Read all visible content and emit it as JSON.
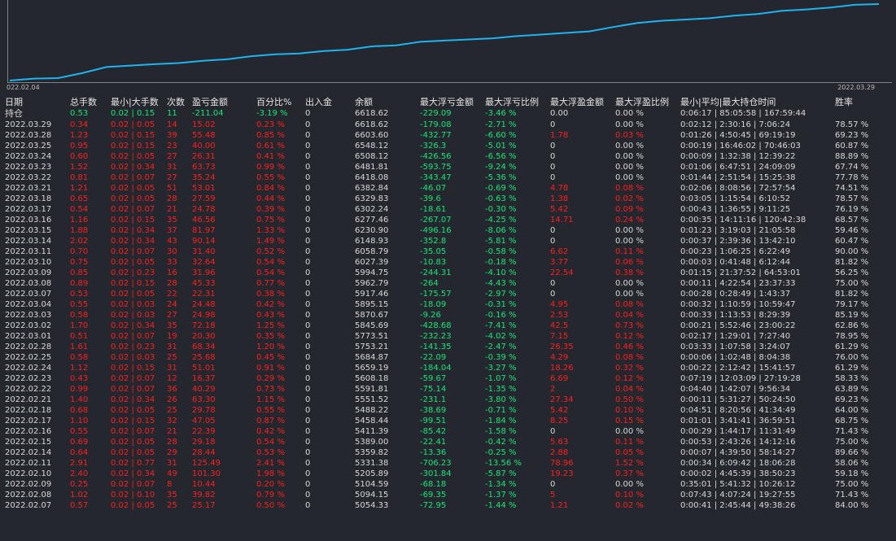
{
  "chart": {
    "start_date": "022.02.04",
    "end_date": "2022.03.29",
    "line_color": "#1eb4f0",
    "curve": [
      5054.33,
      5094.15,
      5104.59,
      5205.89,
      5331.38,
      5359.82,
      5389.0,
      5411.39,
      5458.44,
      5488.22,
      5551.52,
      5591.81,
      5608.18,
      5659.19,
      5684.87,
      5753.21,
      5773.51,
      5845.69,
      5870.67,
      5895.15,
      5917.46,
      5962.79,
      5994.75,
      6027.39,
      6058.79,
      6148.93,
      6230.9,
      6277.46,
      6302.24,
      6329.83,
      6382.84,
      6418.08,
      6481.81,
      6508.12,
      6548.12,
      6603.6,
      6618.62
    ]
  },
  "headers": {
    "date": "日期",
    "lots": "总手数",
    "minmax_lots": "最小|大手数",
    "count": "次数",
    "profit": "盈亏金额",
    "percent": "百分比%",
    "inout": "出入金",
    "balance": "余额",
    "max_float_loss": "最大浮亏金额",
    "max_float_loss_ratio": "最大浮亏比例",
    "max_float_profit": "最大浮盈金额",
    "max_float_profit_ratio": "最大浮盈比例",
    "hold_time": "最小|平均|最大持仓时间",
    "winrate": "胜率"
  },
  "position_row": {
    "label": "持仓",
    "lots": "0.53",
    "minmax": "0.02 | 0.15",
    "count": "11",
    "profit": "-211.04",
    "percent": "-3.19 %",
    "inout": "0",
    "balance": "6618.62",
    "mfl": "-229.09",
    "mflr": "-3.46 %",
    "mfp": "0.00",
    "mfpr": "0.00 %",
    "hold": "0:06:17 | 85:05:58 | 167:59:44",
    "win": ""
  },
  "rows": [
    {
      "date": "2022.03.29",
      "lots": "0.34",
      "minmax": "0.02 | 0.05",
      "count": "14",
      "profit": "15.02",
      "percent": "0.23 %",
      "inout": "0",
      "balance": "6618.62",
      "mfl": "-179.08",
      "mflr": "-2.71 %",
      "mfp": "0",
      "mfpr": "0.00 %",
      "hold": "0:02:12 | 2:30:16 | 7:06:24",
      "win": "78.57 %"
    },
    {
      "date": "2022.03.28",
      "lots": "1.23",
      "minmax": "0.02 | 0.15",
      "count": "39",
      "profit": "55.48",
      "percent": "0.85 %",
      "inout": "0",
      "balance": "6603.60",
      "mfl": "-432.77",
      "mflr": "-6.60 %",
      "mfp": "1.78",
      "mfpr": "0.03 %",
      "hold": "0:01:26 | 4:50:45 | 69:19:19",
      "win": "69.23 %"
    },
    {
      "date": "2022.03.25",
      "lots": "0.95",
      "minmax": "0.02 | 0.15",
      "count": "23",
      "profit": "40.00",
      "percent": "0.61 %",
      "inout": "0",
      "balance": "6548.12",
      "mfl": "-326.3",
      "mflr": "-5.01 %",
      "mfp": "0",
      "mfpr": "0.00 %",
      "hold": "0:00:19 | 16:46:02 | 70:46:03",
      "win": "60.87 %"
    },
    {
      "date": "2022.03.24",
      "lots": "0.60",
      "minmax": "0.02 | 0.05",
      "count": "27",
      "profit": "26.31",
      "percent": "0.41 %",
      "inout": "0",
      "balance": "6508.12",
      "mfl": "-426.56",
      "mflr": "-6.56 %",
      "mfp": "0",
      "mfpr": "0.00 %",
      "hold": "0:00:09 | 1:32:38 | 12:39:22",
      "win": "88.89 %"
    },
    {
      "date": "2022.03.23",
      "lots": "1.52",
      "minmax": "0.02 | 0.34",
      "count": "31",
      "profit": "63.73",
      "percent": "0.99 %",
      "inout": "0",
      "balance": "6481.81",
      "mfl": "-593.75",
      "mflr": "-9.24 %",
      "mfp": "0",
      "mfpr": "0.00 %",
      "hold": "0:01:06 | 6:47:51 | 24:09:09",
      "win": "67.74 %"
    },
    {
      "date": "2022.03.22",
      "lots": "0.81",
      "minmax": "0.02 | 0.07",
      "count": "27",
      "profit": "35.24",
      "percent": "0.55 %",
      "inout": "0",
      "balance": "6418.08",
      "mfl": "-343.47",
      "mflr": "-5.36 %",
      "mfp": "0",
      "mfpr": "0.00 %",
      "hold": "0:01:44 | 2:51:54 | 15:25:38",
      "win": "77.78 %"
    },
    {
      "date": "2022.03.21",
      "lots": "1.21",
      "minmax": "0.02 | 0.05",
      "count": "51",
      "profit": "53.01",
      "percent": "0.84 %",
      "inout": "0",
      "balance": "6382.84",
      "mfl": "-46.07",
      "mflr": "-0.69 %",
      "mfp": "4.78",
      "mfpr": "0.08 %",
      "hold": "0:02:06 | 8:08:56 | 72:57:54",
      "win": "74.51 %"
    },
    {
      "date": "2022.03.18",
      "lots": "0.65",
      "minmax": "0.02 | 0.05",
      "count": "28",
      "profit": "27.59",
      "percent": "0.44 %",
      "inout": "0",
      "balance": "6329.83",
      "mfl": "-39.6",
      "mflr": "-0.63 %",
      "mfp": "1.38",
      "mfpr": "0.02 %",
      "hold": "0:03:05 | 1:15:54 | 6:10:52",
      "win": "78.57 %"
    },
    {
      "date": "2022.03.17",
      "lots": "0.54",
      "minmax": "0.02 | 0.07",
      "count": "21",
      "profit": "24.78",
      "percent": "0.39 %",
      "inout": "0",
      "balance": "6302.24",
      "mfl": "-18.61",
      "mflr": "-0.30 %",
      "mfp": "5.42",
      "mfpr": "0.09 %",
      "hold": "0:00:43 | 1:36:55 | 9:11:25",
      "win": "76.19 %"
    },
    {
      "date": "2022.03.16",
      "lots": "1.16",
      "minmax": "0.02 | 0.15",
      "count": "35",
      "profit": "46.56",
      "percent": "0.75 %",
      "inout": "0",
      "balance": "6277.46",
      "mfl": "-267.07",
      "mflr": "-4.25 %",
      "mfp": "14.71",
      "mfpr": "0.24 %",
      "hold": "0:00:35 | 14:11:16 | 120:42:38",
      "win": "68.57 %"
    },
    {
      "date": "2022.03.15",
      "lots": "1.88",
      "minmax": "0.02 | 0.34",
      "count": "37",
      "profit": "81.97",
      "percent": "1.33 %",
      "inout": "0",
      "balance": "6230.90",
      "mfl": "-496.16",
      "mflr": "-8.06 %",
      "mfp": "0",
      "mfpr": "0.00 %",
      "hold": "0:01:23 | 3:19:03 | 21:05:58",
      "win": "59.46 %"
    },
    {
      "date": "2022.03.14",
      "lots": "2.02",
      "minmax": "0.02 | 0.34",
      "count": "43",
      "profit": "90.14",
      "percent": "1.49 %",
      "inout": "0",
      "balance": "6148.93",
      "mfl": "-352.8",
      "mflr": "-5.81 %",
      "mfp": "0",
      "mfpr": "0.00 %",
      "hold": "0:00:37 | 2:39:36 | 13:42:10",
      "win": "60.47 %"
    },
    {
      "date": "2022.03.11",
      "lots": "0.70",
      "minmax": "0.02 | 0.07",
      "count": "30",
      "profit": "31.40",
      "percent": "0.52 %",
      "inout": "0",
      "balance": "6058.79",
      "mfl": "-35.05",
      "mflr": "-0.58 %",
      "mfp": "6.62",
      "mfpr": "0.11 %",
      "hold": "0:00:23 | 1:06:25 | 6:22:49",
      "win": "90.00 %"
    },
    {
      "date": "2022.03.10",
      "lots": "0.75",
      "minmax": "0.02 | 0.05",
      "count": "33",
      "profit": "32.64",
      "percent": "0.54 %",
      "inout": "0",
      "balance": "6027.39",
      "mfl": "-10.83",
      "mflr": "-0.18 %",
      "mfp": "3.77",
      "mfpr": "0.06 %",
      "hold": "0:00:03 | 0:41:48 | 6:12:44",
      "win": "81.82 %"
    },
    {
      "date": "2022.03.09",
      "lots": "0.85",
      "minmax": "0.02 | 0.23",
      "count": "16",
      "profit": "31.96",
      "percent": "0.54 %",
      "inout": "0",
      "balance": "5994.75",
      "mfl": "-244.31",
      "mflr": "-4.10 %",
      "mfp": "22.54",
      "mfpr": "0.38 %",
      "hold": "0:01:15 | 21:37:52 | 64:53:01",
      "win": "56.25 %"
    },
    {
      "date": "2022.03.08",
      "lots": "0.89",
      "minmax": "0.02 | 0.15",
      "count": "28",
      "profit": "45.33",
      "percent": "0.77 %",
      "inout": "0",
      "balance": "5962.79",
      "mfl": "-264",
      "mflr": "-4.43 %",
      "mfp": "0",
      "mfpr": "0.00 %",
      "hold": "0:00:11 | 4:22:54 | 23:37:33",
      "win": "75.00 %"
    },
    {
      "date": "2022.03.07",
      "lots": "0.53",
      "minmax": "0.02 | 0.05",
      "count": "22",
      "profit": "22.31",
      "percent": "0.38 %",
      "inout": "0",
      "balance": "5917.46",
      "mfl": "-175.57",
      "mflr": "-2.97 %",
      "mfp": "0",
      "mfpr": "0.00 %",
      "hold": "0:00:28 | 0:28:49 | 1:43:37",
      "win": "81.82 %"
    },
    {
      "date": "2022.03.04",
      "lots": "0.55",
      "minmax": "0.02 | 0.03",
      "count": "24",
      "profit": "24.48",
      "percent": "0.42 %",
      "inout": "0",
      "balance": "5895.15",
      "mfl": "-18.09",
      "mflr": "-0.31 %",
      "mfp": "4.95",
      "mfpr": "0.08 %",
      "hold": "0:00:32 | 1:10:59 | 10:59:47",
      "win": "79.17 %"
    },
    {
      "date": "2022.03.03",
      "lots": "0.58",
      "minmax": "0.02 | 0.03",
      "count": "27",
      "profit": "24.98",
      "percent": "0.43 %",
      "inout": "0",
      "balance": "5870.67",
      "mfl": "-9.26",
      "mflr": "-0.16 %",
      "mfp": "2.53",
      "mfpr": "0.04 %",
      "hold": "0:00:33 | 1:13:53 | 8:29:39",
      "win": "85.19 %"
    },
    {
      "date": "2022.03.02",
      "lots": "1.70",
      "minmax": "0.02 | 0.34",
      "count": "35",
      "profit": "72.18",
      "percent": "1.25 %",
      "inout": "0",
      "balance": "5845.69",
      "mfl": "-428.68",
      "mflr": "-7.41 %",
      "mfp": "42.5",
      "mfpr": "0.73 %",
      "hold": "0:00:21 | 5:52:46 | 23:00:22",
      "win": "62.86 %"
    },
    {
      "date": "2022.03.01",
      "lots": "0.51",
      "minmax": "0.02 | 0.07",
      "count": "19",
      "profit": "20.30",
      "percent": "0.35 %",
      "inout": "0",
      "balance": "5773.51",
      "mfl": "-232.23",
      "mflr": "-4.02 %",
      "mfp": "7.15",
      "mfpr": "0.12 %",
      "hold": "0:02:17 | 1:29:01 | 7:27:40",
      "win": "78.95 %"
    },
    {
      "date": "2022.02.28",
      "lots": "1.61",
      "minmax": "0.02 | 0.23",
      "count": "31",
      "profit": "68.34",
      "percent": "1.20 %",
      "inout": "0",
      "balance": "5753.21",
      "mfl": "-141.35",
      "mflr": "-2.47 %",
      "mfp": "26.35",
      "mfpr": "0.46 %",
      "hold": "0:03:33 | 1:07:58 | 3:24:07",
      "win": "61.29 %"
    },
    {
      "date": "2022.02.25",
      "lots": "0.58",
      "minmax": "0.02 | 0.03",
      "count": "25",
      "profit": "25.68",
      "percent": "0.45 %",
      "inout": "0",
      "balance": "5684.87",
      "mfl": "-22.09",
      "mflr": "-0.39 %",
      "mfp": "4.29",
      "mfpr": "0.08 %",
      "hold": "0:00:06 | 1:02:48 | 8:04:38",
      "win": "76.00 %"
    },
    {
      "date": "2022.02.24",
      "lots": "1.12",
      "minmax": "0.02 | 0.15",
      "count": "31",
      "profit": "51.01",
      "percent": "0.91 %",
      "inout": "0",
      "balance": "5659.19",
      "mfl": "-184.04",
      "mflr": "-3.27 %",
      "mfp": "18.26",
      "mfpr": "0.32 %",
      "hold": "0:00:22 | 2:12:42 | 15:41:57",
      "win": "61.29 %"
    },
    {
      "date": "2022.02.23",
      "lots": "0.43",
      "minmax": "0.02 | 0.07",
      "count": "12",
      "profit": "16.37",
      "percent": "0.29 %",
      "inout": "0",
      "balance": "5608.18",
      "mfl": "-59.67",
      "mflr": "-1.07 %",
      "mfp": "6.69",
      "mfpr": "0.12 %",
      "hold": "0:07:19 | 12:03:09 | 27:19:28",
      "win": "58.33 %"
    },
    {
      "date": "2022.02.22",
      "lots": "0.99",
      "minmax": "0.02 | 0.07",
      "count": "36",
      "profit": "40.29",
      "percent": "0.73 %",
      "inout": "0",
      "balance": "5591.81",
      "mfl": "-75.14",
      "mflr": "-1.35 %",
      "mfp": "2",
      "mfpr": "0.04 %",
      "hold": "0:04:40 | 1:42:07 | 9:56:34",
      "win": "63.89 %"
    },
    {
      "date": "2022.02.21",
      "lots": "1.40",
      "minmax": "0.02 | 0.34",
      "count": "26",
      "profit": "63.30",
      "percent": "1.15 %",
      "inout": "0",
      "balance": "5551.52",
      "mfl": "-231.1",
      "mflr": "-3.80 %",
      "mfp": "27.34",
      "mfpr": "0.50 %",
      "hold": "0:00:11 | 5:31:27 | 50:24:50",
      "win": "69.23 %"
    },
    {
      "date": "2022.02.18",
      "lots": "0.68",
      "minmax": "0.02 | 0.05",
      "count": "25",
      "profit": "29.78",
      "percent": "0.55 %",
      "inout": "0",
      "balance": "5488.22",
      "mfl": "-38.69",
      "mflr": "-0.71 %",
      "mfp": "5.42",
      "mfpr": "0.10 %",
      "hold": "0:04:51 | 8:20:56 | 41:34:49",
      "win": "64.00 %"
    },
    {
      "date": "2022.02.17",
      "lots": "1.10",
      "minmax": "0.02 | 0.15",
      "count": "32",
      "profit": "47.05",
      "percent": "0.87 %",
      "inout": "0",
      "balance": "5458.44",
      "mfl": "-99.51",
      "mflr": "-1.84 %",
      "mfp": "8.25",
      "mfpr": "0.15 %",
      "hold": "0:01:01 | 3:41:41 | 36:59:51",
      "win": "68.75 %"
    },
    {
      "date": "2022.02.16",
      "lots": "0.55",
      "minmax": "0.02 | 0.07",
      "count": "21",
      "profit": "22.39",
      "percent": "0.42 %",
      "inout": "0",
      "balance": "5411.39",
      "mfl": "-85.42",
      "mflr": "-1.58 %",
      "mfp": "0",
      "mfpr": "0.00 %",
      "hold": "0:00:29 | 1:44:17 | 11:31:49",
      "win": "71.43 %"
    },
    {
      "date": "2022.02.15",
      "lots": "0.69",
      "minmax": "0.02 | 0.05",
      "count": "28",
      "profit": "29.18",
      "percent": "0.54 %",
      "inout": "0",
      "balance": "5389.00",
      "mfl": "-22.41",
      "mflr": "-0.42 %",
      "mfp": "5.63",
      "mfpr": "0.11 %",
      "hold": "0:00:53 | 2:43:26 | 14:12:16",
      "win": "75.00 %"
    },
    {
      "date": "2022.02.14",
      "lots": "0.64",
      "minmax": "0.02 | 0.05",
      "count": "29",
      "profit": "28.44",
      "percent": "0.53 %",
      "inout": "0",
      "balance": "5359.82",
      "mfl": "-13.36",
      "mflr": "-0.25 %",
      "mfp": "2.88",
      "mfpr": "0.05 %",
      "hold": "0:00:07 | 4:39:50 | 58:14:27",
      "win": "89.66 %"
    },
    {
      "date": "2022.02.11",
      "lots": "2.91",
      "minmax": "0.02 | 0.77",
      "count": "31",
      "profit": "125.49",
      "percent": "2.41 %",
      "inout": "0",
      "balance": "5331.38",
      "mfl": "-706.23",
      "mflr": "-13.56 %",
      "mfp": "78.96",
      "mfpr": "1.52 %",
      "hold": "0:00:34 | 6:09:42 | 18:06:28",
      "win": "58.06 %"
    },
    {
      "date": "2022.02.10",
      "lots": "2.40",
      "minmax": "0.02 | 0.34",
      "count": "49",
      "profit": "101.30",
      "percent": "1.98 %",
      "inout": "0",
      "balance": "5205.89",
      "mfl": "-301.84",
      "mflr": "-5.87 %",
      "mfp": "19.23",
      "mfpr": "0.37 %",
      "hold": "0:00:02 | 4:45:39 | 38:50:23",
      "win": "59.18 %"
    },
    {
      "date": "2022.02.09",
      "lots": "0.25",
      "minmax": "0.02 | 0.07",
      "count": "8",
      "profit": "10.44",
      "percent": "0.20 %",
      "inout": "0",
      "balance": "5104.59",
      "mfl": "-68.18",
      "mflr": "-1.34 %",
      "mfp": "0",
      "mfpr": "0.00 %",
      "hold": "0:35:01 | 5:41:32 | 10:26:12",
      "win": "75.00 %"
    },
    {
      "date": "2022.02.08",
      "lots": "1.02",
      "minmax": "0.02 | 0.10",
      "count": "35",
      "profit": "39.82",
      "percent": "0.79 %",
      "inout": "0",
      "balance": "5094.15",
      "mfl": "-69.35",
      "mflr": "-1.37 %",
      "mfp": "5",
      "mfpr": "0.10 %",
      "hold": "0:07:43 | 4:07:24 | 19:27:55",
      "win": "71.43 %"
    },
    {
      "date": "2022.02.07",
      "lots": "0.57",
      "minmax": "0.02 | 0.05",
      "count": "25",
      "profit": "25.17",
      "percent": "0.50 %",
      "inout": "0",
      "balance": "5054.33",
      "mfl": "-72.95",
      "mflr": "-1.44 %",
      "mfp": "1.21",
      "mfpr": "0.02 %",
      "hold": "0:00:41 | 2:45:44 | 49:38:26",
      "win": "84.00 %"
    }
  ],
  "colors": {
    "positive": "#ff1f1f",
    "negative": "#12e87a",
    "neutral": "#d8d8d8",
    "background": "#24272d"
  }
}
